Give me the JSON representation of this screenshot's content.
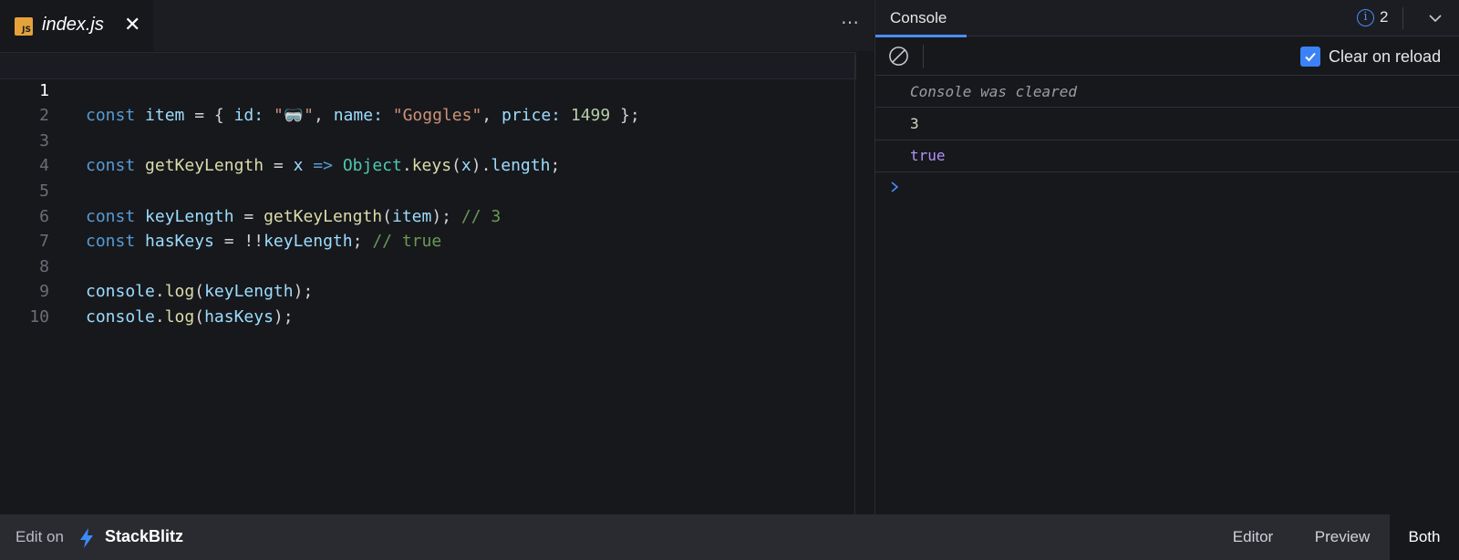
{
  "editor": {
    "tab": {
      "filename": "index.js",
      "icon": "js-file-icon",
      "icon_label": "JS",
      "icon_color": "#e5a23a"
    },
    "more_label": "⋯",
    "close_label": "✕",
    "active_line": 1,
    "lines": [
      {
        "n": "1"
      },
      {
        "n": "2"
      },
      {
        "n": "3"
      },
      {
        "n": "4"
      },
      {
        "n": "5"
      },
      {
        "n": "6"
      },
      {
        "n": "7"
      },
      {
        "n": "8"
      },
      {
        "n": "9"
      },
      {
        "n": "10"
      }
    ],
    "code": {
      "l1": {
        "kw": "const",
        "name": "item",
        "p1": " = { ",
        "k1": "id:",
        "s1": "\"🥽\"",
        "p2": ", ",
        "k2": "name:",
        "s2": "\"Goggles\"",
        "p3": ", ",
        "k3": "price:",
        "n3": "1499",
        "p4": " };"
      },
      "l3": {
        "kw": "const",
        "name": "getKeyLength",
        "p1": " = ",
        "param": "x",
        "arrow": "=>",
        "cls": "Object",
        "dot1": ".",
        "fn": "keys",
        "p2": "(",
        "arg": "x",
        "p3": ").",
        "prop": "length",
        "p4": ";"
      },
      "l5": {
        "kw": "const",
        "name": "keyLength",
        "p1": " = ",
        "fn": "getKeyLength",
        "p2": "(",
        "arg": "item",
        "p3": "); ",
        "cmt": "// 3"
      },
      "l6": {
        "kw": "const",
        "name": "hasKeys",
        "p1": " = !!",
        "arg": "keyLength",
        "p2": "; ",
        "cmt": "// true"
      },
      "l8": {
        "obj": "console",
        "dot": ".",
        "fn": "log",
        "p1": "(",
        "arg": "keyLength",
        "p2": ");"
      },
      "l9": {
        "obj": "console",
        "dot": ".",
        "fn": "log",
        "p1": "(",
        "arg": "hasKeys",
        "p2": ");"
      }
    }
  },
  "console": {
    "tab_label": "Console",
    "info_glyph": "i",
    "info_count": "2",
    "clear_on_reload_label": "Clear on reload",
    "clear_on_reload_checked": true,
    "entries": [
      {
        "text": "Console was cleared",
        "kind": "system"
      },
      {
        "text": "3",
        "kind": "number"
      },
      {
        "text": "true",
        "kind": "boolean"
      }
    ]
  },
  "bottombar": {
    "edit_on": "Edit on",
    "brand": "StackBlitz",
    "views": [
      {
        "label": "Editor",
        "active": false
      },
      {
        "label": "Preview",
        "active": false
      },
      {
        "label": "Both",
        "active": true
      }
    ]
  },
  "colors": {
    "accent": "#4a8df5",
    "brand_bolt": "#3b8cf6",
    "checkbox": "#3b82f6"
  }
}
